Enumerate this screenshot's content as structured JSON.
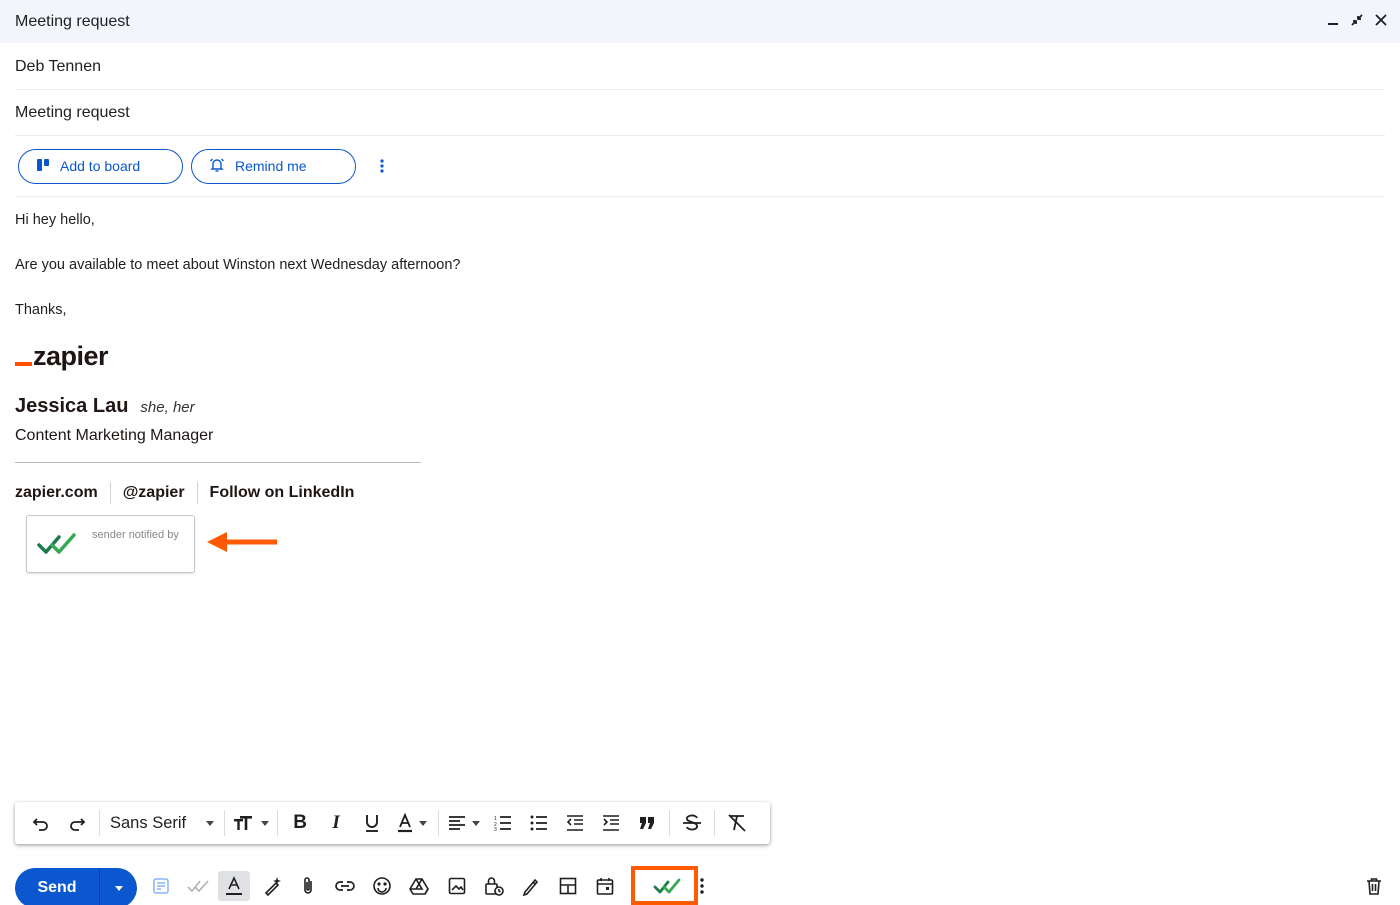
{
  "window": {
    "title": "Meeting request",
    "controls": [
      "minimize-icon",
      "collapse-icon",
      "close-icon"
    ]
  },
  "compose": {
    "to": "Deb Tennen",
    "subject": "Meeting request"
  },
  "addons": {
    "board_label": "Add to board",
    "remind_label": "Remind me"
  },
  "message": {
    "greeting": "Hi hey hello,",
    "line": "Are you available to meet about Winston next Wednesday afternoon?",
    "closing": "Thanks,"
  },
  "signature": {
    "logo_text": "zapier",
    "name": "Jessica Lau",
    "pronouns": "she, her",
    "title": "Content Marketing Manager",
    "links": [
      "zapier.com",
      "@zapier",
      "Follow on LinkedIn"
    ],
    "notify_text": "sender notified by"
  },
  "format_toolbar": {
    "font": "Sans Serif",
    "buttons": [
      "undo-icon",
      "redo-icon",
      "text-size-icon",
      "bold-icon",
      "italic-icon",
      "underline-icon",
      "text-color-icon",
      "align-icon",
      "numbered-list-icon",
      "bulleted-list-icon",
      "indent-less-icon",
      "indent-more-icon",
      "quote-icon",
      "strikethrough-icon",
      "remove-formatting-icon"
    ]
  },
  "bottom_bar": {
    "send_label": "Send"
  },
  "colors": {
    "accent": "#0b57d0",
    "highlight": "#ff5a00",
    "check": "#1e8e3e",
    "titlebar": "#f2f6fc",
    "zapier_orange": "#ff4f00"
  }
}
